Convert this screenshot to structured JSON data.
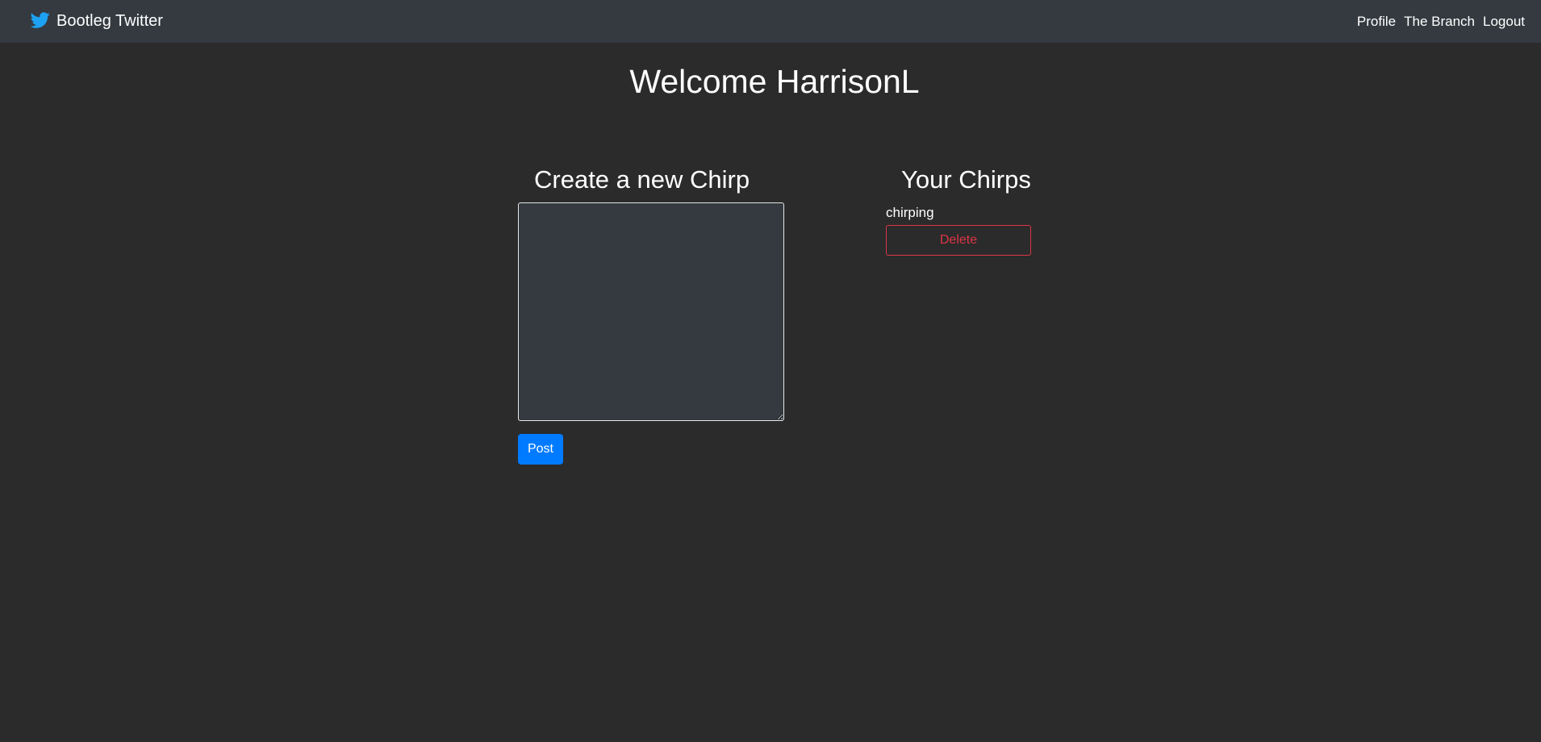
{
  "navbar": {
    "brand": {
      "label": "Bootleg Twitter",
      "icon": "twitter-bird-icon",
      "icon_color": "#1da1f2"
    },
    "links": [
      {
        "label": "Profile"
      },
      {
        "label": "The Branch"
      },
      {
        "label": "Logout"
      }
    ],
    "background": "#343a40"
  },
  "page": {
    "welcome": "Welcome HarrisonL",
    "background": "#2b2b2b"
  },
  "create": {
    "title": "Create a new Chirp",
    "textarea_value": "",
    "post_label": "Post",
    "post_color": "#007bff"
  },
  "chirps": {
    "title": "Your Chirps",
    "items": [
      {
        "text": "chirping",
        "delete_label": "Delete"
      }
    ],
    "delete_color": "#dc3545"
  }
}
